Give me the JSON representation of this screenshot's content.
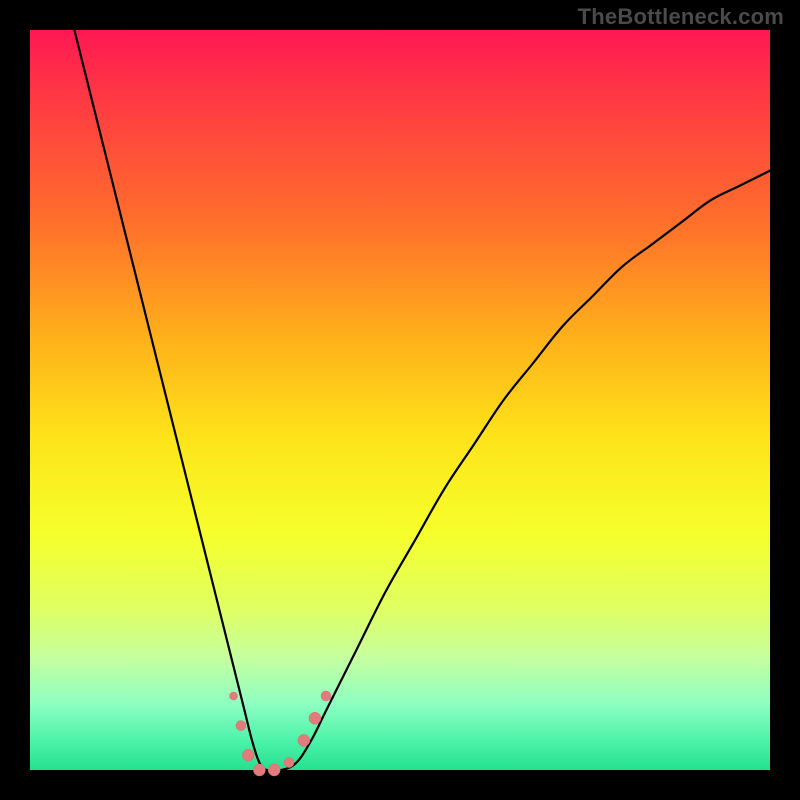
{
  "watermark": "TheBottleneck.com",
  "colors": {
    "background": "#000000",
    "gradient_top": "#ff1752",
    "gradient_bottom": "#24e08f",
    "curve": "#000000",
    "marker": "#e17c7c"
  },
  "chart_data": {
    "type": "line",
    "title": "",
    "xlabel": "",
    "ylabel": "",
    "xlim": [
      0,
      100
    ],
    "ylim": [
      0,
      100
    ],
    "series": [
      {
        "name": "curve",
        "x": [
          6,
          8,
          10,
          12,
          14,
          16,
          18,
          20,
          22,
          24,
          26,
          28,
          29,
          30,
          31,
          32,
          34,
          36,
          38,
          40,
          44,
          48,
          52,
          56,
          60,
          64,
          68,
          72,
          76,
          80,
          84,
          88,
          92,
          96,
          100
        ],
        "y": [
          100,
          92,
          84,
          76,
          68,
          60,
          52,
          44,
          36,
          28,
          20,
          12,
          8,
          4,
          1,
          0,
          0,
          1,
          4,
          8,
          16,
          24,
          31,
          38,
          44,
          50,
          55,
          60,
          64,
          68,
          71,
          74,
          77,
          79,
          81
        ]
      }
    ],
    "markers": [
      {
        "x": 27.5,
        "y": 10,
        "r": 4
      },
      {
        "x": 28.5,
        "y": 6,
        "r": 5
      },
      {
        "x": 29.5,
        "y": 2,
        "r": 6
      },
      {
        "x": 31,
        "y": 0,
        "r": 6
      },
      {
        "x": 33,
        "y": 0,
        "r": 6
      },
      {
        "x": 35,
        "y": 1,
        "r": 5
      },
      {
        "x": 37,
        "y": 4,
        "r": 6
      },
      {
        "x": 38.5,
        "y": 7,
        "r": 6
      },
      {
        "x": 40,
        "y": 10,
        "r": 5
      }
    ]
  }
}
